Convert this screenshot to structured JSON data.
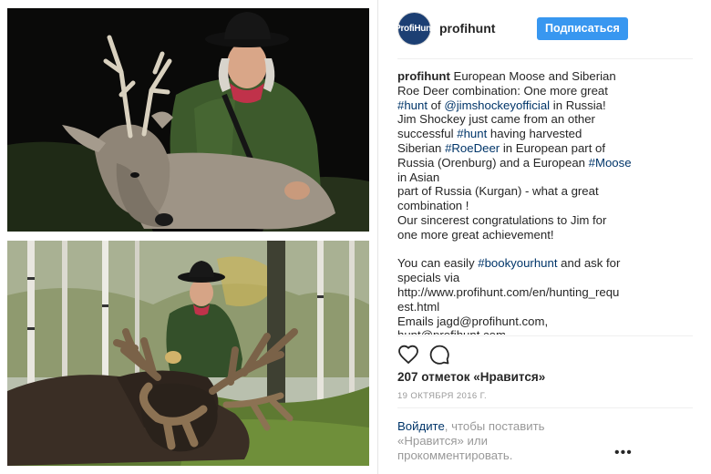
{
  "post": {
    "username": "profihunt",
    "avatar_text": "ProfiHunt",
    "follow_label": "Подписаться",
    "caption": {
      "user": "profihunt",
      "lines": [
        [
          {
            "t": "European Moose and Siberian",
            "k": "text"
          }
        ],
        [
          {
            "t": "Roe Deer combination: One more great",
            "k": "text"
          }
        ],
        [
          {
            "t": "#hunt",
            "k": "tag"
          },
          {
            "t": " of ",
            "k": "text"
          },
          {
            "t": "@jimshockeyofficial",
            "k": "tag"
          },
          {
            "t": " in Russia!",
            "k": "text"
          }
        ],
        [
          {
            "t": "Jim Shockey just came from an other",
            "k": "text"
          }
        ],
        [
          {
            "t": "successful ",
            "k": "text"
          },
          {
            "t": "#hunt",
            "k": "tag"
          },
          {
            "t": " having harvested",
            "k": "text"
          }
        ],
        [
          {
            "t": "Siberian ",
            "k": "text"
          },
          {
            "t": "#RoeDeer",
            "k": "tag"
          },
          {
            "t": " in European part of",
            "k": "text"
          }
        ],
        [
          {
            "t": "Russia (Orenburg) and a European ",
            "k": "text"
          },
          {
            "t": "#Moose",
            "k": "tag"
          }
        ],
        [
          {
            "t": "in Asian",
            "k": "text"
          }
        ],
        [
          {
            "t": "part of Russia (Kurgan) - what a great",
            "k": "text"
          }
        ],
        [
          {
            "t": "combination !",
            "k": "text"
          }
        ],
        [
          {
            "t": "Our sincerest congratulations to Jim for",
            "k": "text"
          }
        ],
        [
          {
            "t": "one more great achievement!",
            "k": "text"
          }
        ],
        [
          {
            "t": "",
            "k": "text"
          }
        ],
        [
          {
            "t": "You can easily ",
            "k": "text"
          },
          {
            "t": "#bookyourhunt",
            "k": "tag"
          },
          {
            "t": " and ask for",
            "k": "text"
          }
        ],
        [
          {
            "t": "specials via",
            "k": "text"
          }
        ],
        [
          {
            "t": "http://www.profihunt.com/en/hunting_requ",
            "k": "text"
          }
        ],
        [
          {
            "t": "est.html",
            "k": "text"
          }
        ],
        [
          {
            "t": "Emails jagd@profihunt.com,",
            "k": "text"
          }
        ],
        [
          {
            "t": "hunt@profihunt.com",
            "k": "text"
          }
        ]
      ]
    },
    "likes_label": "207 отметок «Нравится»",
    "date_label": "19 ОКТЯБРЯ 2016 Г.",
    "login": {
      "link": "Войдите",
      "rest": ", чтобы поставить «Нравится» или прокомментировать."
    },
    "icons": {
      "like": "heart-icon",
      "comment": "comment-icon",
      "more": "more-options-icon"
    },
    "colors": {
      "accent": "#3897f0",
      "link": "#003569",
      "muted": "#999999"
    }
  }
}
